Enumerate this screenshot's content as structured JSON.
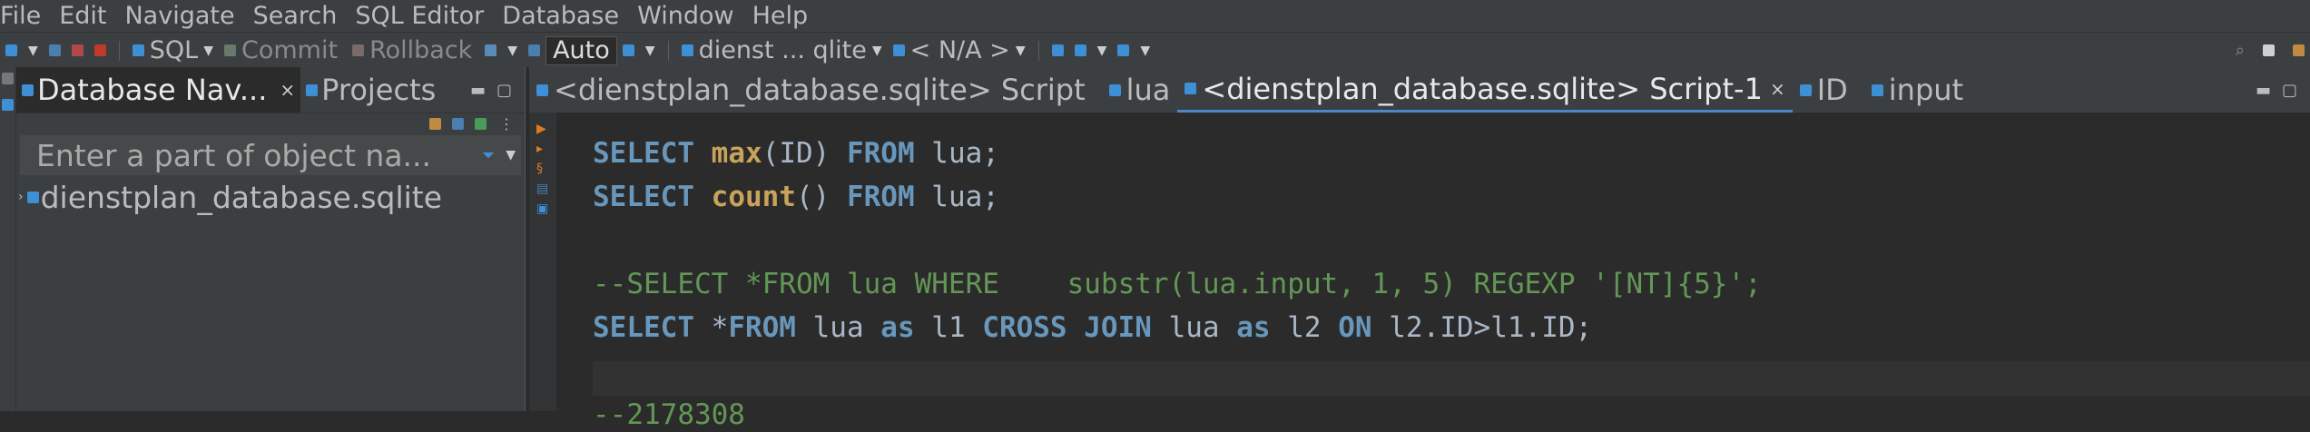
{
  "menu": [
    "File",
    "Edit",
    "Navigate",
    "Search",
    "SQL Editor",
    "Database",
    "Window",
    "Help"
  ],
  "toolbar": {
    "sql_label": "SQL",
    "commit_label": "Commit",
    "rollback_label": "Rollback",
    "transaction_mode": "Auto",
    "datasource_label": "dienst ... qlite",
    "schema_label": "< N/A >"
  },
  "navigator": {
    "tabs": [
      {
        "label": "Database Nav...",
        "active": true
      },
      {
        "label": "Projects",
        "active": false
      }
    ],
    "filter_placeholder": "Enter a part of object na...",
    "tree": [
      {
        "label": "dienstplan_database.sqlite",
        "icon": "sqlite-db-icon"
      }
    ]
  },
  "editor_tabs": [
    {
      "label": "<dienstplan_database.sqlite> Script",
      "active": false
    },
    {
      "label": "lua",
      "active": false
    },
    {
      "label": "<dienstplan_database.sqlite> Script-1",
      "active": true
    },
    {
      "label": "ID",
      "active": false
    },
    {
      "label": "input",
      "active": false
    }
  ],
  "editor": {
    "lines": [
      {
        "tokens": [
          {
            "t": "SELECT",
            "c": "kw"
          },
          {
            "t": " "
          },
          {
            "t": "max",
            "c": "fn"
          },
          {
            "t": "(ID) ",
            "c": "id"
          },
          {
            "t": "FROM",
            "c": "kw"
          },
          {
            "t": " lua;",
            "c": "id"
          }
        ]
      },
      {
        "tokens": [
          {
            "t": "SELECT",
            "c": "kw"
          },
          {
            "t": " "
          },
          {
            "t": "count",
            "c": "fn"
          },
          {
            "t": "() ",
            "c": "id"
          },
          {
            "t": "FROM",
            "c": "kw"
          },
          {
            "t": " lua;",
            "c": "id"
          }
        ]
      },
      {
        "tokens": []
      },
      {
        "tokens": [
          {
            "t": "--SELECT *FROM lua WHERE    substr(lua.input, 1, 5) REGEXP '[NT]{5}';",
            "c": "cm"
          }
        ]
      },
      {
        "tokens": [
          {
            "t": "SELECT",
            "c": "kw"
          },
          {
            "t": " *",
            "c": "id"
          },
          {
            "t": "FROM",
            "c": "kw"
          },
          {
            "t": " lua ",
            "c": "id"
          },
          {
            "t": "as",
            "c": "kw"
          },
          {
            "t": " l1 ",
            "c": "id"
          },
          {
            "t": "CROSS JOIN",
            "c": "kw"
          },
          {
            "t": " lua ",
            "c": "id"
          },
          {
            "t": "as",
            "c": "kw"
          },
          {
            "t": " l2 ",
            "c": "id"
          },
          {
            "t": "ON",
            "c": "kw"
          },
          {
            "t": " l2.ID>l1.ID;",
            "c": "id"
          }
        ]
      },
      {
        "tokens": []
      },
      {
        "tokens": [
          {
            "t": "--2178308",
            "c": "cm"
          }
        ]
      }
    ]
  },
  "colors": {
    "keyword": "#6897bb",
    "function": "#c8a35a",
    "comment": "#629755",
    "active_tab_underline": "#4a88c7"
  }
}
